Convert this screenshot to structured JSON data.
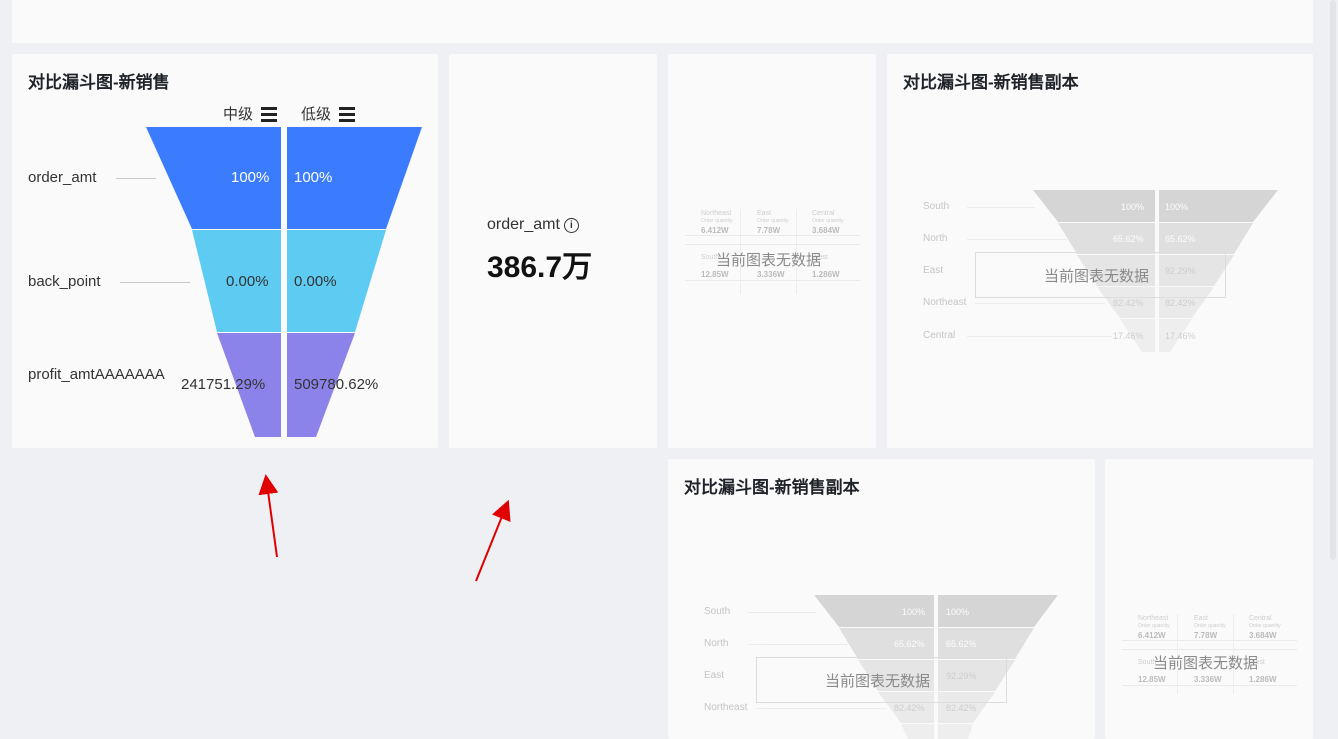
{
  "cards": {
    "funnel_main": {
      "title": "对比漏斗图-新销售",
      "columns": [
        {
          "label": "中级",
          "icon": "menu-icon"
        },
        {
          "label": "低级",
          "icon": "menu-icon"
        }
      ],
      "rows": [
        {
          "label": "order_amt",
          "left": "100%",
          "right": "100%",
          "color": "#3b7cff"
        },
        {
          "label": "back_point",
          "left": "0.00%",
          "right": "0.00%",
          "color": "#5ecbf3"
        },
        {
          "label": "profit_amtAAAAAAA",
          "left": "241751.29%",
          "right": "509780.62%",
          "color": "#8b83e9"
        }
      ]
    },
    "kpi": {
      "label": "order_amt",
      "icon": "info-icon",
      "value": "386.7万"
    },
    "table_empty_1": {
      "empty_text": "当前图表无数据",
      "ghost": {
        "headers": [
          "Northeast",
          "East",
          "Central"
        ],
        "sublabels": [
          "Order quantity",
          "Order quantity",
          "Order quantity"
        ],
        "row1": [
          "6.412W",
          "7.78W",
          "3.684W"
        ],
        "headers2": [
          "South",
          "",
          "West"
        ],
        "row2": [
          "12.85W",
          "3.336W",
          "1.286W"
        ]
      }
    },
    "funnel_copy_1": {
      "title": "对比漏斗图-新销售副本",
      "empty_text": "当前图表无数据",
      "ghost_rows": [
        {
          "label": "South",
          "left": "100%",
          "right": "100%"
        },
        {
          "label": "North",
          "left": "65.62%",
          "right": "65.62%"
        },
        {
          "label": "East",
          "left": "",
          "right": "92.29%"
        },
        {
          "label": "Northeast",
          "left": "82.42%",
          "right": "82.42%"
        },
        {
          "label": "Central",
          "left": "17.46%",
          "right": "17.46%"
        }
      ]
    },
    "funnel_copy_2": {
      "title": "对比漏斗图-新销售副本",
      "empty_text": "当前图表无数据",
      "ghost_rows": [
        {
          "label": "South",
          "left": "100%",
          "right": "100%"
        },
        {
          "label": "North",
          "left": "65.62%",
          "right": "65.62%"
        },
        {
          "label": "East",
          "left": "",
          "right": "92.29%"
        },
        {
          "label": "Northeast",
          "left": "82.42%",
          "right": "82.42%"
        }
      ]
    },
    "table_empty_2": {
      "empty_text": "当前图表无数据",
      "ghost": {
        "headers": [
          "Northeast",
          "East",
          "Central"
        ],
        "sublabels": [
          "Order quantity",
          "Order quantity",
          "Order quantity"
        ],
        "row1": [
          "6.412W",
          "7.78W",
          "3.684W"
        ],
        "headers2": [
          "South",
          "",
          "West"
        ],
        "row2": [
          "12.85W",
          "3.336W",
          "1.286W"
        ]
      }
    }
  },
  "colors": {
    "background": "#eef0f3",
    "card": "#fafafa",
    "annotation_arrow": "#e00000",
    "ghost_funnel": "#c4c4c4"
  }
}
